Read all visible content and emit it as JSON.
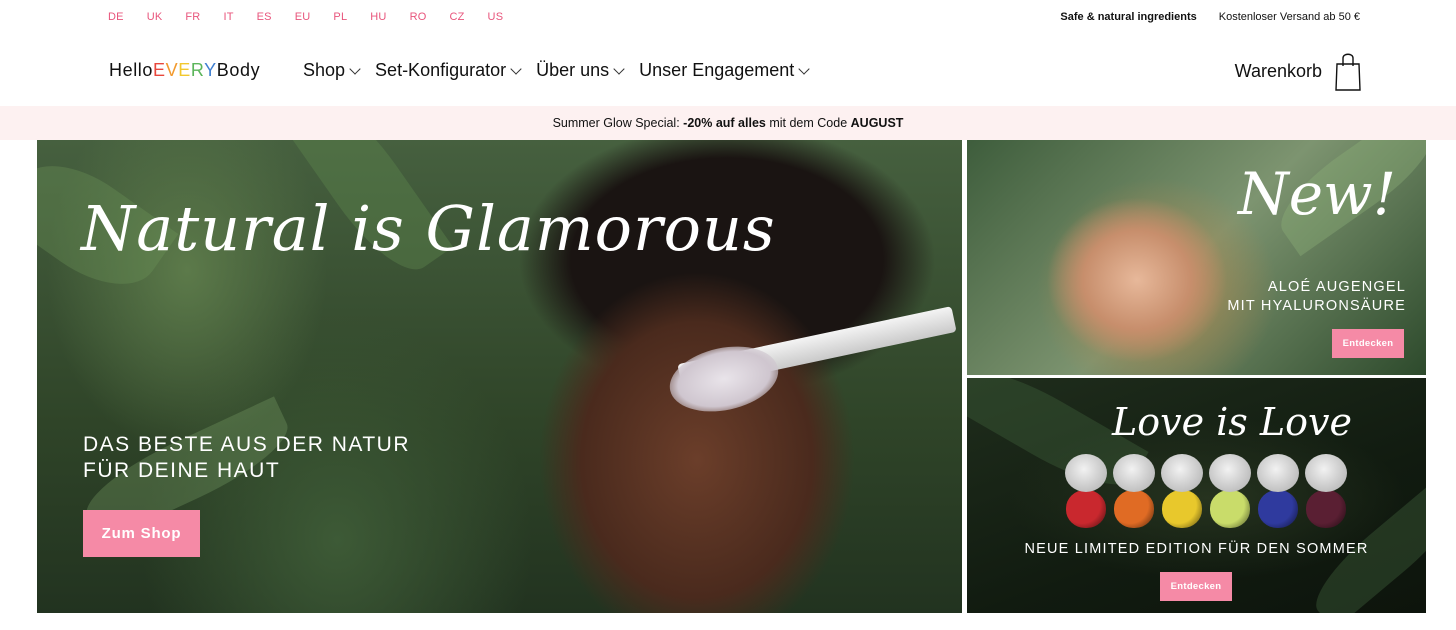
{
  "topbar": {
    "countries": [
      "DE",
      "UK",
      "FR",
      "IT",
      "ES",
      "EU",
      "PL",
      "HU",
      "RO",
      "CZ",
      "US"
    ],
    "ingredients": "Safe & natural ingredients",
    "shipping": "Kostenloser Versand ab 50 €"
  },
  "logo": {
    "part1": "Hello",
    "letters": [
      "E",
      "V",
      "E",
      "R",
      "Y"
    ],
    "part2": "Body"
  },
  "nav": {
    "items": [
      "Shop",
      "Set-Konfigurator",
      "Über uns",
      "Unser Engagement"
    ],
    "cart": "Warenkorb"
  },
  "promo": {
    "prefix": "Summer Glow Special:",
    "discount": "-20% auf alles",
    "middle": "mit dem Code",
    "code": "AUGUST"
  },
  "hero": {
    "script": "Natural is Glamorous",
    "line1": "DAS BESTE AUS DER NATUR",
    "line2": "FÜR DEINE HAUT",
    "button": "Zum Shop"
  },
  "card_top": {
    "script": "New!",
    "line1": "ALOÉ AUGENGEL",
    "line2": "MIT HYALURONSÄURE",
    "button": "Entdecken"
  },
  "card_bottom": {
    "script": "Love is Love",
    "text": "NEUE LIMITED EDITION FÜR DEN SOMMER",
    "button": "Entdecken"
  },
  "colors": {
    "accent": "#f58aa6",
    "country_link": "#e8557c",
    "promo_bg": "#fdf1f1",
    "logo_rainbow": [
      "#e8473c",
      "#f29a2e",
      "#f2c82e",
      "#5bb55a",
      "#3f7fd1"
    ],
    "jar_colors": [
      "#c9282e",
      "#e06b24",
      "#e8c82c",
      "#c9dc6a",
      "#2f3a9e",
      "#5a1f33"
    ]
  },
  "icons": {
    "bag": "shopping-bag-icon",
    "chevron": "chevron-down-icon"
  }
}
